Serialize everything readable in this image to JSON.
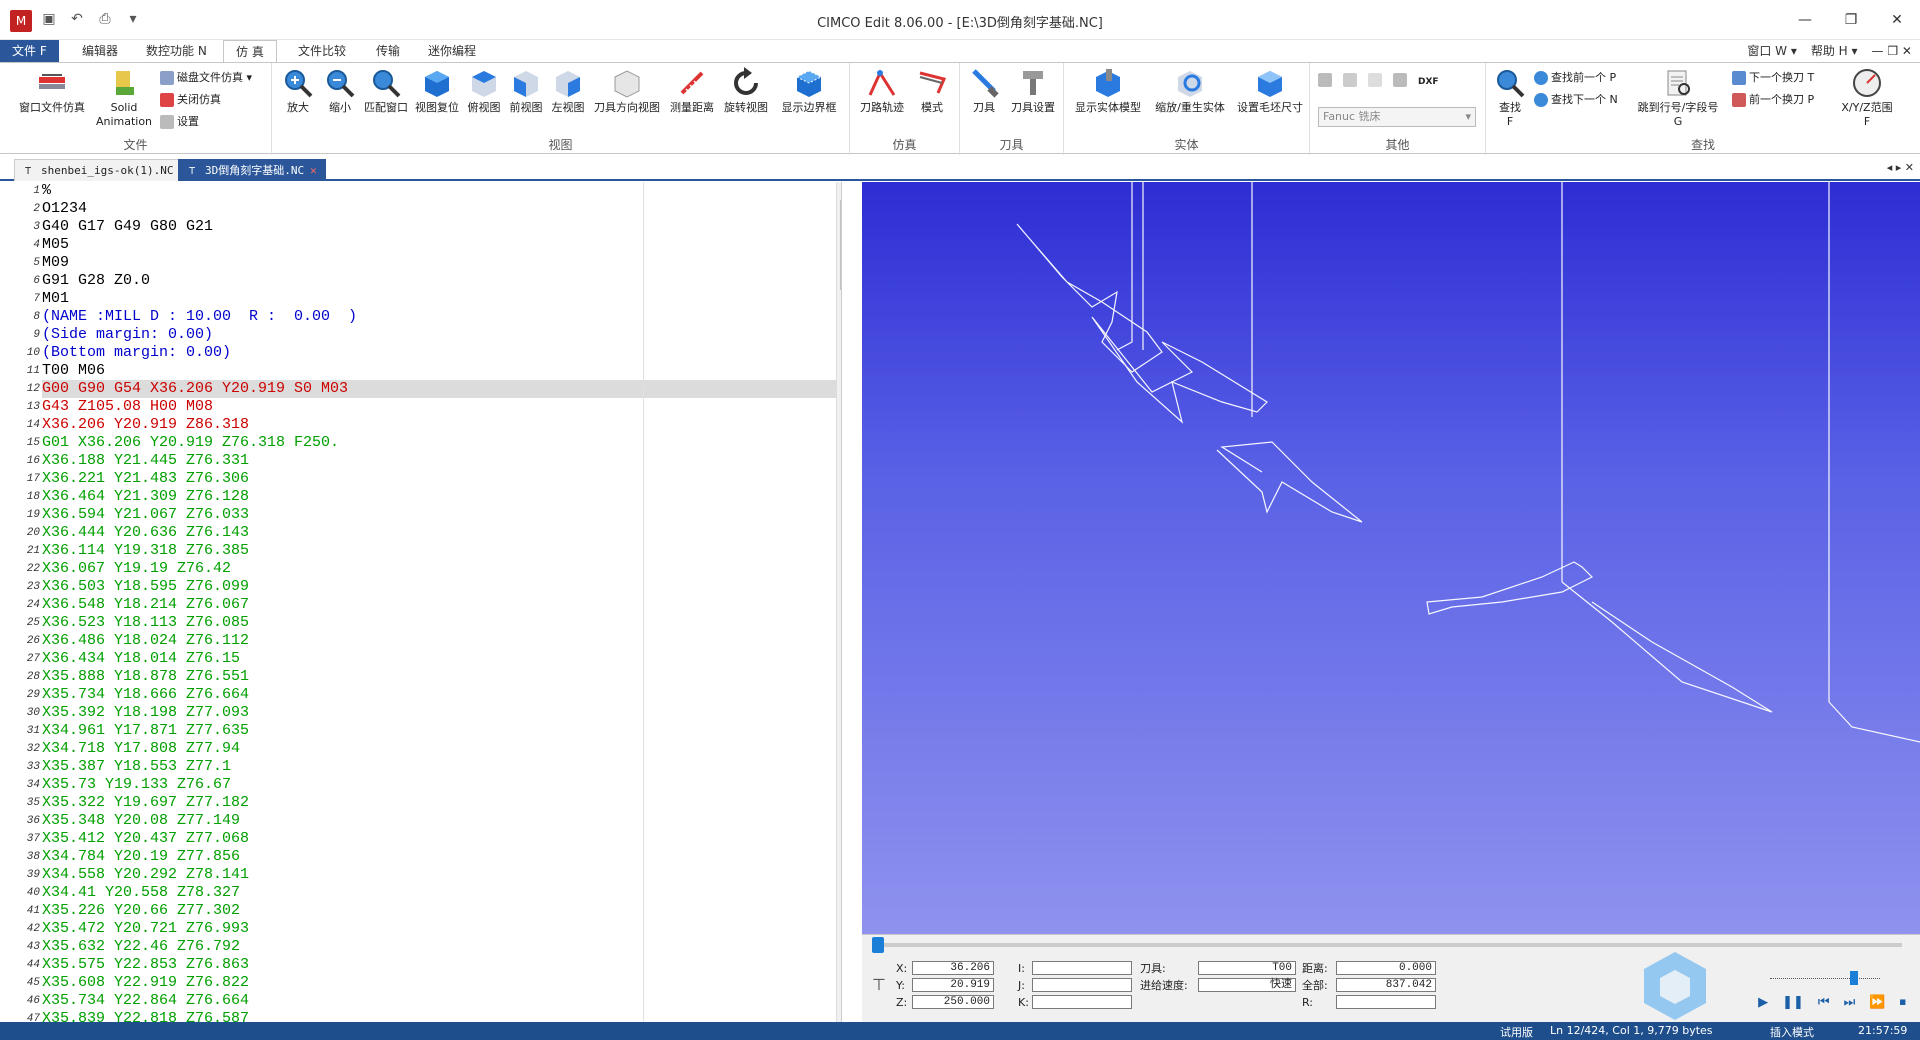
{
  "titlebar": {
    "title": "CIMCO Edit 8.06.00 - [E:\\3D倒角刻字基础.NC]",
    "app_icon": "M",
    "qat_icons": [
      "save-icon",
      "undo-icon",
      "print-icon",
      "customize-icon"
    ],
    "window_buttons": [
      "—",
      "❐",
      "✕"
    ]
  },
  "ribbon_tabs": {
    "items": [
      "文件 F",
      "编辑器",
      "数控功能 N",
      "仿 真",
      "文件比较",
      "传输",
      "迷你编程"
    ],
    "active": "仿 真",
    "right": [
      "窗口 W ▾",
      "帮助 H ▾",
      "— ❐ ✕"
    ]
  },
  "ribbon": {
    "groups": {
      "file": "文件",
      "view": "视图",
      "simulate": "仿真",
      "tool": "刀具",
      "solid": "实体",
      "other": "其他",
      "find": "查找"
    },
    "file": {
      "window_sim": "窗口文件仿真",
      "solid_anim_1": "Solid",
      "solid_anim_2": "Animation",
      "disk_sim": "磁盘文件仿真 ▾",
      "close_sim": "关闭仿真",
      "settings": "设置"
    },
    "view": {
      "zoom_in": "放大",
      "zoom_out": "缩小",
      "fit_window": "匹配窗口",
      "view_reset": "视图复位",
      "top_view": "俯视图",
      "front_view": "前视图",
      "left_view": "左视图",
      "tool_dir_view": "刀具方向视图",
      "measure": "测量距离",
      "rotate_view": "旋转视图",
      "show_bbox": "显示边界框"
    },
    "simulate": {
      "toolpath": "刀路轨迹",
      "mode": "模式"
    },
    "tool": {
      "tool": "刀具",
      "tool_settings": "刀具设置"
    },
    "solid": {
      "show_solid": "显示实体模型",
      "zoom_regen": "缩放/重生实体",
      "stock_size": "设置毛坯尺寸"
    },
    "other": {
      "machine_select": "Fanuc 铣床",
      "dxf_label": "DXF"
    },
    "find": {
      "find": "查找",
      "find_key": "F",
      "find_prev": "查找前一个 P",
      "find_next": "查找下一个 N",
      "goto_line_1": "跳到行号/字段号",
      "goto_line_2": "G",
      "next_tool": "下一个换刀 T",
      "prev_tool": "前一个换刀 P",
      "xyz_range_1": "X/Y/Z范围",
      "xyz_range_2": "F"
    }
  },
  "doc_tabs": [
    {
      "label": "shenbei_igs-ok(1).NC",
      "active": false
    },
    {
      "label": "3D倒角刻字基础.NC",
      "active": true
    }
  ],
  "editor": {
    "current_line": 12,
    "lines": [
      {
        "n": "1",
        "t": "%",
        "c": "#000000"
      },
      {
        "n": "2",
        "t": "O1234",
        "c": "#000000"
      },
      {
        "n": "3",
        "t": "G40 G17 G49 G80 G21",
        "c": "#000000"
      },
      {
        "n": "4",
        "t": "M05",
        "c": "#000000"
      },
      {
        "n": "5",
        "t": "M09",
        "c": "#000000"
      },
      {
        "n": "6",
        "t": "G91 G28 Z0.0",
        "c": "#000000"
      },
      {
        "n": "7",
        "t": "M01",
        "c": "#000000"
      },
      {
        "n": "8",
        "t": "(NAME :MILL D : 10.00  R :  0.00  )",
        "c": "#0000cc"
      },
      {
        "n": "9",
        "t": "(Side margin: 0.00)",
        "c": "#0000cc"
      },
      {
        "n": "10",
        "t": "(Bottom margin: 0.00)",
        "c": "#0000cc"
      },
      {
        "n": "11",
        "t": "T00 M06",
        "c": "#000000"
      },
      {
        "n": "12",
        "t": "G00 G90 G54 X36.206 Y20.919 S0 M03",
        "c": "#cc0000"
      },
      {
        "n": "13",
        "t": "G43 Z105.08 H00 M08",
        "c": "#cc0000"
      },
      {
        "n": "14",
        "t": "X36.206 Y20.919 Z86.318",
        "c": "#cc0000"
      },
      {
        "n": "15",
        "t": "G01 X36.206 Y20.919 Z76.318 F250.",
        "c": "#00a000"
      },
      {
        "n": "16",
        "t": "X36.188 Y21.445 Z76.331",
        "c": "#00a000"
      },
      {
        "n": "17",
        "t": "X36.221 Y21.483 Z76.306",
        "c": "#00a000"
      },
      {
        "n": "18",
        "t": "X36.464 Y21.309 Z76.128",
        "c": "#00a000"
      },
      {
        "n": "19",
        "t": "X36.594 Y21.067 Z76.033",
        "c": "#00a000"
      },
      {
        "n": "20",
        "t": "X36.444 Y20.636 Z76.143",
        "c": "#00a000"
      },
      {
        "n": "21",
        "t": "X36.114 Y19.318 Z76.385",
        "c": "#00a000"
      },
      {
        "n": "22",
        "t": "X36.067 Y19.19 Z76.42",
        "c": "#00a000"
      },
      {
        "n": "23",
        "t": "X36.503 Y18.595 Z76.099",
        "c": "#00a000"
      },
      {
        "n": "24",
        "t": "X36.548 Y18.214 Z76.067",
        "c": "#00a000"
      },
      {
        "n": "25",
        "t": "X36.523 Y18.113 Z76.085",
        "c": "#00a000"
      },
      {
        "n": "26",
        "t": "X36.486 Y18.024 Z76.112",
        "c": "#00a000"
      },
      {
        "n": "27",
        "t": "X36.434 Y18.014 Z76.15",
        "c": "#00a000"
      },
      {
        "n": "28",
        "t": "X35.888 Y18.878 Z76.551",
        "c": "#00a000"
      },
      {
        "n": "29",
        "t": "X35.734 Y18.666 Z76.664",
        "c": "#00a000"
      },
      {
        "n": "30",
        "t": "X35.392 Y18.198 Z77.093",
        "c": "#00a000"
      },
      {
        "n": "31",
        "t": "X34.961 Y17.871 Z77.635",
        "c": "#00a000"
      },
      {
        "n": "32",
        "t": "X34.718 Y17.808 Z77.94",
        "c": "#00a000"
      },
      {
        "n": "33",
        "t": "X35.387 Y18.553 Z77.1",
        "c": "#00a000"
      },
      {
        "n": "34",
        "t": "X35.73 Y19.133 Z76.67",
        "c": "#00a000"
      },
      {
        "n": "35",
        "t": "X35.322 Y19.697 Z77.182",
        "c": "#00a000"
      },
      {
        "n": "36",
        "t": "X35.348 Y20.08 Z77.149",
        "c": "#00a000"
      },
      {
        "n": "37",
        "t": "X35.412 Y20.437 Z77.068",
        "c": "#00a000"
      },
      {
        "n": "38",
        "t": "X34.784 Y20.19 Z77.856",
        "c": "#00a000"
      },
      {
        "n": "39",
        "t": "X34.558 Y20.292 Z78.141",
        "c": "#00a000"
      },
      {
        "n": "40",
        "t": "X34.41 Y20.558 Z78.327",
        "c": "#00a000"
      },
      {
        "n": "41",
        "t": "X35.226 Y20.66 Z77.302",
        "c": "#00a000"
      },
      {
        "n": "42",
        "t": "X35.472 Y20.721 Z76.993",
        "c": "#00a000"
      },
      {
        "n": "43",
        "t": "X35.632 Y22.46 Z76.792",
        "c": "#00a000"
      },
      {
        "n": "44",
        "t": "X35.575 Y22.853 Z76.863",
        "c": "#00a000"
      },
      {
        "n": "45",
        "t": "X35.608 Y22.919 Z76.822",
        "c": "#00a000"
      },
      {
        "n": "46",
        "t": "X35.734 Y22.864 Z76.664",
        "c": "#00a000"
      },
      {
        "n": "47",
        "t": "X35.839 Y22.818 Z76.587",
        "c": "#00a000"
      }
    ]
  },
  "sim_panel": {
    "x_label": "X:",
    "x_value": "36.206",
    "y_label": "Y:",
    "y_value": "20.919",
    "z_label": "Z:",
    "z_value": "250.000",
    "i_label": "I:",
    "j_label": "J:",
    "k_label": "K:",
    "tool_label": "刀具:",
    "tool_value": "T00",
    "feed_label": "进给速度:",
    "feed_value": "快速",
    "dist_label": "距离:",
    "dist_value": "0.000",
    "total_label": "全部:",
    "total_value": "837.042",
    "r_label": "R:",
    "progress": 0.0
  },
  "statusbar": {
    "trial": "试用版",
    "position": "Ln 12/424, Col 1, 9,779 bytes",
    "mode": "插入模式",
    "time": "21:57:59"
  },
  "colors": {
    "accent": "#2b579a",
    "comment": "#0000cc",
    "rapid": "#cc0000",
    "feed": "#00a000",
    "viewport_top": "#2d2dd4",
    "viewport_bottom": "#8f92ee"
  }
}
